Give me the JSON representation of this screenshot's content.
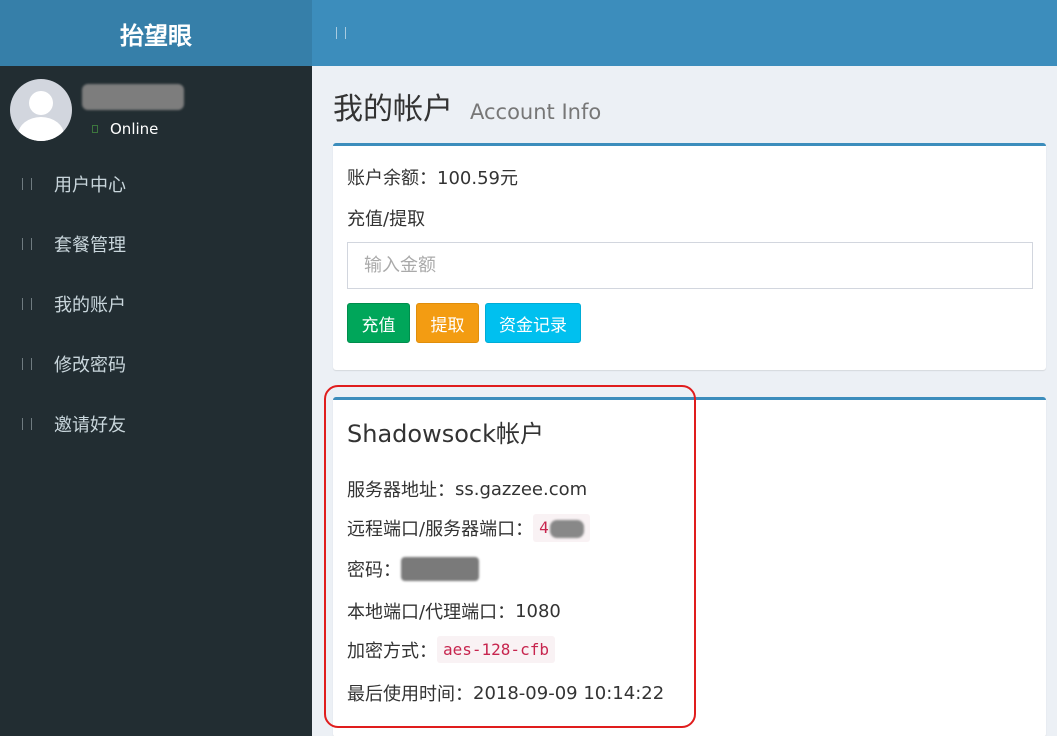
{
  "sidebar": {
    "logo": "抬望眼",
    "user_status": "Online",
    "items": [
      {
        "label": "用户中心"
      },
      {
        "label": "套餐管理"
      },
      {
        "label": "我的账户"
      },
      {
        "label": "修改密码"
      },
      {
        "label": "邀请好友"
      }
    ]
  },
  "page": {
    "title": "我的帐户",
    "subtitle": "Account Info"
  },
  "balance_box": {
    "balance_label": "账户余额：",
    "balance_value": "100.59元",
    "recharge_label": "充值/提取",
    "amount_placeholder": "输入金额",
    "buttons": {
      "recharge": "充值",
      "withdraw": "提取",
      "records": "资金记录"
    }
  },
  "ss_box": {
    "title": "Shadowsock帐户",
    "server_label": "服务器地址：",
    "server_value": "ss.gazzee.com",
    "port_label": "远程端口/服务器端口：",
    "port_value_visible": "4",
    "password_label": "密码：",
    "local_port_label": "本地端口/代理端口：",
    "local_port_value": "1080",
    "method_label": "加密方式：",
    "method_value": "aes-128-cfb",
    "last_used_label": "最后使用时间：",
    "last_used_value": "2018-09-09 10:14:22"
  },
  "colors": {
    "sidebar_bg": "#222d32",
    "header_bg": "#3c8dbc",
    "logo_bg": "#367fa9",
    "success": "#00a65a",
    "warning": "#f39c12",
    "info": "#00c0ef",
    "annotation_red": "#e01d1d"
  }
}
